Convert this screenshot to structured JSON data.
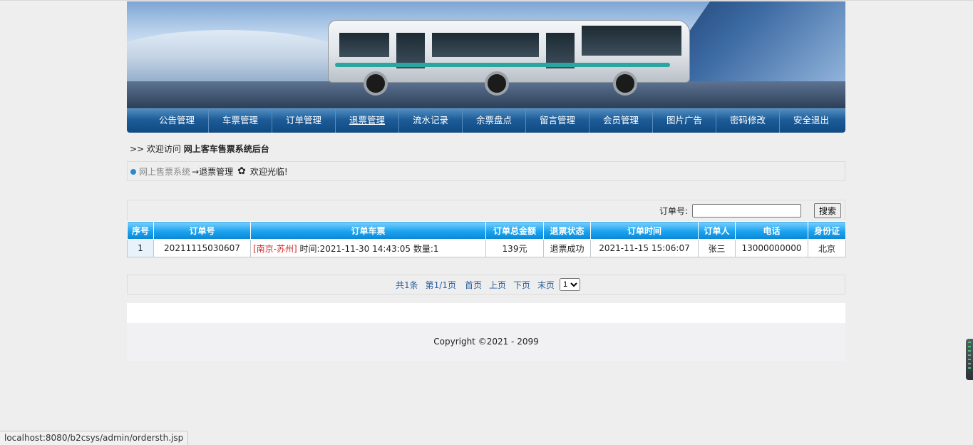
{
  "nav": {
    "items": [
      "公告管理",
      "车票管理",
      "订单管理",
      "退票管理",
      "流水记录",
      "余票盘点",
      "留言管理",
      "会员管理",
      "图片广告",
      "密码修改",
      "安全退出"
    ],
    "active": "退票管理"
  },
  "welcome": {
    "prefix": ">> 欢迎访问",
    "system_name": "网上客车售票系统后台"
  },
  "breadcrumb": {
    "site": "网上售票系统",
    "current": "→退票管理",
    "greeting": "欢迎光临!"
  },
  "search": {
    "label": "订单号:",
    "value": "",
    "button": "搜索"
  },
  "table": {
    "headers": [
      "序号",
      "订单号",
      "订单车票",
      "订单总金额",
      "退票状态",
      "订单时间",
      "订单人",
      "电话",
      "身份证"
    ],
    "rows": [
      {
        "idx": "1",
        "order_no": "20211115030607",
        "route": "[南京-苏州]",
        "ticket_info": "时间:2021-11-30 14:43:05 数量:1",
        "amount": "139元",
        "status": "退票成功",
        "order_time": "2021-11-15 15:06:07",
        "person": "张三",
        "phone": "13000000000",
        "idcard": "北京"
      }
    ]
  },
  "pager": {
    "total": "共1条",
    "page_info": "第1/1页",
    "first": "首页",
    "prev": "上页",
    "next": "下页",
    "last": "末页",
    "page_select": "1"
  },
  "footer": {
    "copyright": "Copyright ©2021 - 2099"
  },
  "statusbar": {
    "url": "localhost:8080/b2csys/admin/ordersth.jsp"
  }
}
